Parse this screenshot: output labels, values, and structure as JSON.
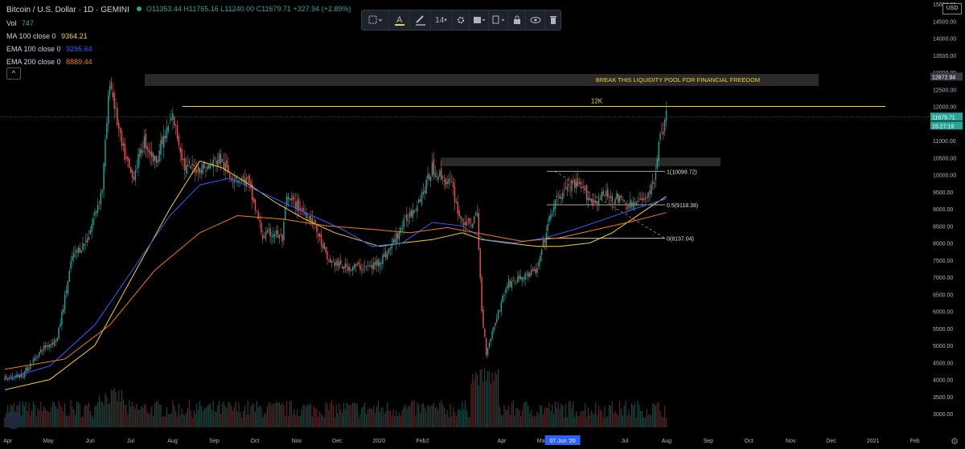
{
  "legend": {
    "title": "Bitcoin / U.S. Dollar · 1D · GEMINI",
    "vol_label": "Vol",
    "vol_value": "747",
    "ma100_label": "MA 100 close 0",
    "ma100_value": "9364.21",
    "ma100_color": "#f7d21e",
    "ema100_label": "EMA 100 close 0",
    "ema100_value": "9295.64",
    "ema100_color": "#2962ff",
    "ema200_label": "EMA 200 close 0",
    "ema200_value": "8889.44",
    "ema200_color": "#f57c00",
    "collapse_icon": "^"
  },
  "ohlc": "O11353.44 H11765.16 L11240.00 C11679.71 +327.94 (+2.89%)",
  "toolbar": {
    "font_size": "14"
  },
  "axis": {
    "currency": "USD"
  },
  "chart_data": {
    "type": "candlestick",
    "symbol": "BTCUSD",
    "exchange": "GEMINI",
    "interval": "1D",
    "ylim": [
      2600,
      15000
    ],
    "y_ticks": [
      3000,
      3500,
      4000,
      4500,
      5000,
      5500,
      6000,
      6500,
      7000,
      7500,
      8000,
      8500,
      9000,
      9500,
      10000,
      10500,
      11000,
      11500,
      12000,
      12500,
      13000,
      13500,
      14000,
      14500,
      15000
    ],
    "x_ticks": [
      "Apr",
      "May",
      "Jun",
      "Jul",
      "Aug",
      "Sep",
      "Oct",
      "Nov",
      "Dec",
      "2020",
      "Feb",
      "2",
      "Apr",
      "May",
      "07 Jun '20",
      "Jul",
      "Aug",
      "Sep",
      "Oct",
      "Nov",
      "Dec",
      "2021",
      "Feb"
    ],
    "price_path": [
      [
        0,
        4000
      ],
      [
        12,
        4150
      ],
      [
        25,
        4900
      ],
      [
        35,
        5200
      ],
      [
        45,
        7600
      ],
      [
        55,
        8100
      ],
      [
        65,
        9600
      ],
      [
        70,
        12800
      ],
      [
        78,
        10800
      ],
      [
        85,
        9900
      ],
      [
        93,
        11000
      ],
      [
        100,
        10400
      ],
      [
        112,
        11700
      ],
      [
        120,
        10200
      ],
      [
        135,
        10200
      ],
      [
        143,
        10500
      ],
      [
        150,
        10000
      ],
      [
        162,
        9800
      ],
      [
        172,
        8200
      ],
      [
        180,
        8300
      ],
      [
        185,
        8100
      ],
      [
        188,
        9300
      ],
      [
        195,
        9100
      ],
      [
        205,
        8700
      ],
      [
        215,
        7500
      ],
      [
        225,
        7300
      ],
      [
        235,
        7300
      ],
      [
        245,
        7300
      ],
      [
        255,
        7700
      ],
      [
        265,
        8500
      ],
      [
        275,
        9200
      ],
      [
        280,
        9600
      ],
      [
        285,
        10200
      ],
      [
        292,
        9900
      ],
      [
        298,
        9700
      ],
      [
        303,
        8800
      ],
      [
        308,
        8500
      ],
      [
        315,
        8800
      ],
      [
        318,
        6000
      ],
      [
        321,
        4800
      ],
      [
        327,
        5700
      ],
      [
        335,
        6800
      ],
      [
        345,
        7000
      ],
      [
        355,
        7200
      ],
      [
        362,
        8500
      ],
      [
        366,
        9100
      ],
      [
        372,
        9500
      ],
      [
        378,
        9700
      ],
      [
        385,
        9600
      ],
      [
        392,
        9200
      ],
      [
        400,
        9400
      ],
      [
        408,
        9300
      ],
      [
        416,
        9100
      ],
      [
        424,
        9200
      ],
      [
        429,
        9500
      ],
      [
        432,
        9600
      ],
      [
        436,
        10900
      ],
      [
        441,
        11700
      ]
    ],
    "series": [
      {
        "name": "MA 100",
        "color": "#f7d21e",
        "last": 9364.21,
        "path": [
          [
            0,
            3700
          ],
          [
            30,
            4000
          ],
          [
            60,
            5000
          ],
          [
            85,
            7000
          ],
          [
            110,
            9000
          ],
          [
            130,
            10400
          ],
          [
            145,
            10200
          ],
          [
            160,
            9800
          ],
          [
            180,
            9200
          ],
          [
            200,
            8700
          ],
          [
            220,
            8300
          ],
          [
            250,
            7900
          ],
          [
            265,
            8000
          ],
          [
            285,
            8100
          ],
          [
            305,
            8300
          ],
          [
            318,
            8100
          ],
          [
            335,
            8000
          ],
          [
            355,
            7900
          ],
          [
            370,
            7900
          ],
          [
            390,
            8000
          ],
          [
            405,
            8300
          ],
          [
            425,
            8900
          ],
          [
            441,
            9364
          ]
        ]
      },
      {
        "name": "EMA 100",
        "color": "#2962ff",
        "last": 9295.64,
        "path": [
          [
            0,
            4000
          ],
          [
            30,
            4400
          ],
          [
            60,
            5600
          ],
          [
            85,
            7200
          ],
          [
            110,
            8800
          ],
          [
            130,
            9700
          ],
          [
            150,
            9900
          ],
          [
            175,
            9400
          ],
          [
            200,
            8900
          ],
          [
            225,
            8400
          ],
          [
            245,
            7900
          ],
          [
            265,
            8000
          ],
          [
            285,
            8600
          ],
          [
            305,
            8500
          ],
          [
            320,
            8100
          ],
          [
            340,
            8000
          ],
          [
            360,
            8150
          ],
          [
            380,
            8400
          ],
          [
            400,
            8700
          ],
          [
            420,
            9000
          ],
          [
            441,
            9296
          ]
        ]
      },
      {
        "name": "EMA 200",
        "color": "#f57c00",
        "last": 8889.44,
        "path": [
          [
            0,
            4300
          ],
          [
            40,
            4600
          ],
          [
            70,
            5600
          ],
          [
            100,
            7200
          ],
          [
            130,
            8300
          ],
          [
            155,
            8800
          ],
          [
            185,
            8700
          ],
          [
            215,
            8500
          ],
          [
            245,
            8400
          ],
          [
            270,
            8300
          ],
          [
            295,
            8450
          ],
          [
            320,
            8250
          ],
          [
            345,
            8050
          ],
          [
            370,
            8150
          ],
          [
            395,
            8400
          ],
          [
            420,
            8650
          ],
          [
            441,
            8889
          ]
        ]
      }
    ],
    "annotations": {
      "liquidity_zone": {
        "label": "BREAK THIS LIQUIDITY POOL FOR FINANCIAL FREEDOM",
        "low": 12600,
        "high": 12950
      },
      "resistance_12k": {
        "label": "12K",
        "value": 12000
      },
      "range_box": {
        "low": 10250,
        "high": 10500
      },
      "fib_levels": [
        {
          "label": "1(10099.72)",
          "value": 10099.72
        },
        {
          "label": "0.5(9118.38)",
          "value": 9118.38
        },
        {
          "label": "0(8137.04)",
          "value": 8137.04
        }
      ]
    },
    "price_labels": {
      "zone_top": "12872.94",
      "last_price": "11679.71",
      "countdown": "15:27:19"
    }
  }
}
